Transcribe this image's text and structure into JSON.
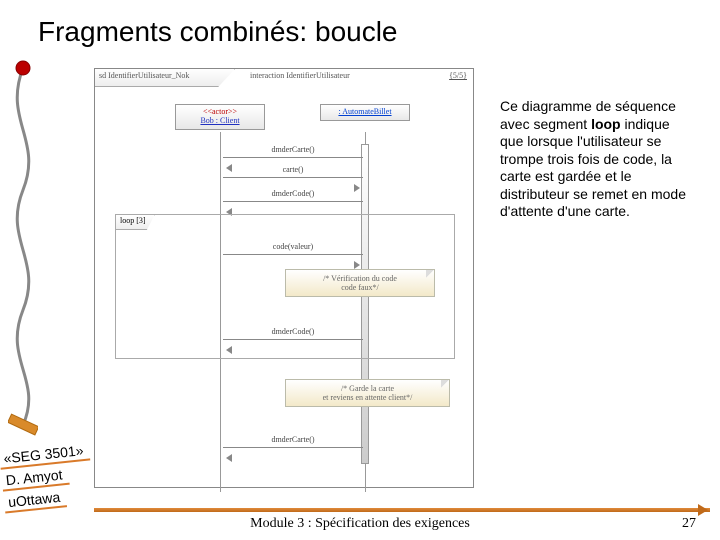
{
  "title": "Fragments combinés: boucle",
  "diagram": {
    "header_label": "sd IdentifierUtilisateur_Nok",
    "header_title": "interaction IdentifierUtilisateur",
    "header_ref": "{5/5}",
    "lifeline_actor_stereo": "<<actor>>",
    "lifeline_actor": "Bob : Client",
    "lifeline_obj": ": AutomateBillet",
    "msg1": "dmderCarte()",
    "msg2": "carte()",
    "msg3": "dmderCode()",
    "loop_label": "loop [3]",
    "msg4": "code(valeur)",
    "note1_l1": "/* Vérification du code",
    "note1_l2": "code faux*/",
    "msg5": "dmderCode()",
    "note2_l1": "/* Garde la carte",
    "note2_l2": "et reviens en attente client*/",
    "msg6": "dmderCarte()"
  },
  "description_pre": "Ce diagramme de séquence avec segment ",
  "description_bold": "loop",
  "description_post": " indique que lorsque l'utilisateur se trompe trois fois de code, la carte est gardée et le distributeur se remet en mode d'attente d'une carte.",
  "tag1": "«SEG 3501»",
  "tag2": "D. Amyot",
  "tag3": "uOttawa",
  "footer": "Module 3 : Spécification des exigences",
  "page": "27"
}
